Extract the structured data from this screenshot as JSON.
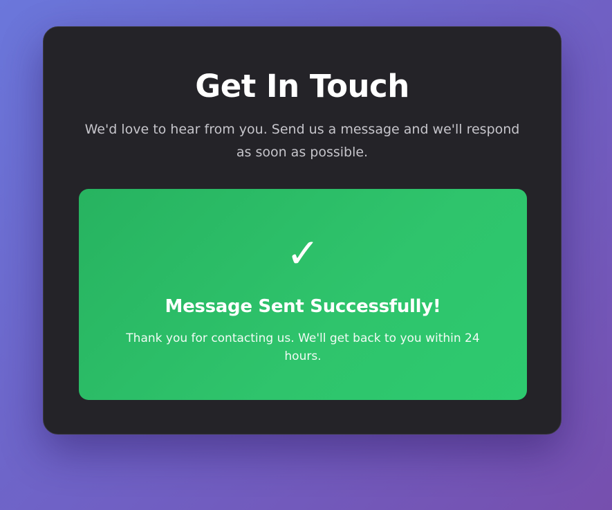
{
  "card": {
    "title": "Get In Touch",
    "subtitle": "We'd love to hear from you. Send us a message and we'll respond as soon as possible."
  },
  "success": {
    "icon": "checkmark-icon",
    "icon_glyph": "✓",
    "title": "Message Sent Successfully!",
    "message": "Thank you for contacting us. We'll get back to you within 24 hours."
  },
  "colors": {
    "background_start": "#6b77db",
    "background_end": "#764fae",
    "card": "#242328",
    "success_green": "#2ec26b",
    "text_primary": "#ffffff",
    "text_muted": "#c6c5cb"
  }
}
